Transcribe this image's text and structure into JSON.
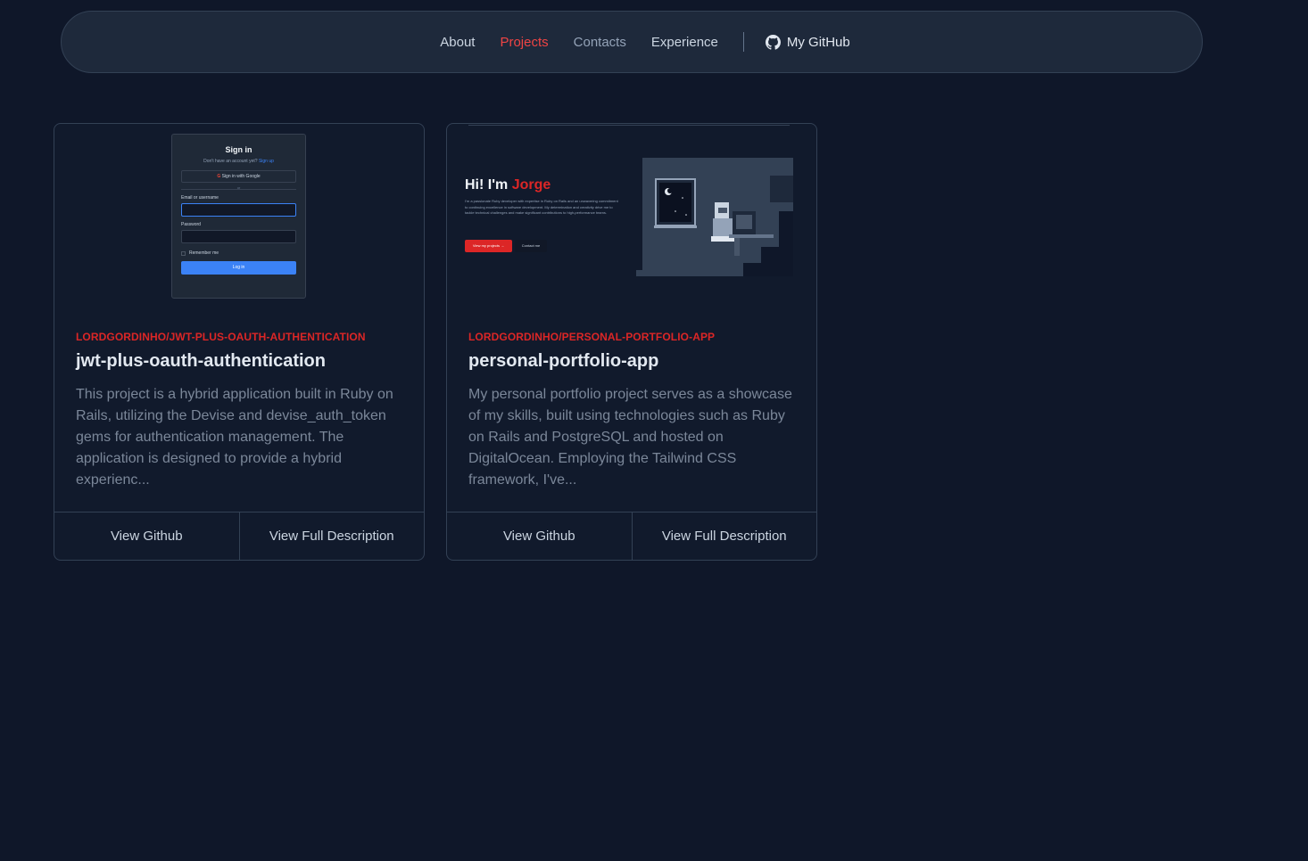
{
  "nav": {
    "links": [
      "About",
      "Projects",
      "Contacts",
      "Experience"
    ],
    "github_label": "My GitHub",
    "colors": {
      "active": "#ef4444",
      "background": "#1e293b"
    }
  },
  "projects": [
    {
      "repo_path": "LORDGORDINHO/JWT-PLUS-OAUTH-AUTHENTICATION",
      "title": "jwt-plus-oauth-authentication",
      "description": "This project is a hybrid application built in Ruby on Rails, utilizing the Devise and devise_auth_token gems for authentication management. The application is designed to provide a hybrid experienc...",
      "actions": [
        "View Github",
        "View Full Description"
      ],
      "preview": {
        "title": "Sign in",
        "subtitle": "Don't have an account yet?",
        "signup": "Sign up",
        "google": "Sign in with Google",
        "or": "or",
        "email_label": "Email or username",
        "password_label": "Password",
        "remember": "Remember me",
        "login": "Log in"
      }
    },
    {
      "repo_path": "LORDGORDINHO/PERSONAL-PORTFOLIO-APP",
      "title": "personal-portfolio-app",
      "description": "My personal portfolio project serves as a showcase of my skills, built using technologies such as Ruby on Rails and PostgreSQL and hosted on DigitalOcean. Employing the Tailwind CSS framework, I've...",
      "actions": [
        "View Github",
        "View Full Description"
      ],
      "preview": {
        "hero_prefix": "Hi! I'm ",
        "hero_name": "Jorge",
        "text": "I'm a passionate Ruby developer with expertise in Ruby on Rails and an unwavering commitment to continuing excellence in software development. My determination and creativity drive me to tackle technical challenges and make significant contributions to high-performance teams.",
        "primary_button": "View my projects →",
        "secondary_button": "Contact me"
      }
    }
  ]
}
